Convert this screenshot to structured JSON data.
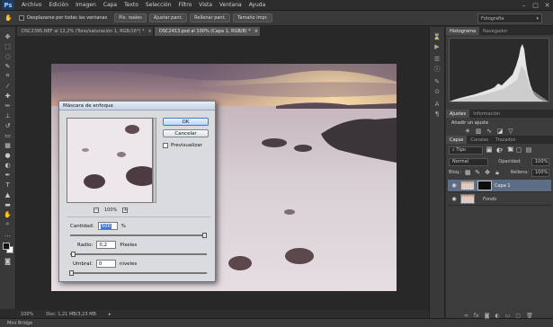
{
  "app": {
    "logo": "Ps"
  },
  "menu": [
    "Archivo",
    "Edición",
    "Imagen",
    "Capa",
    "Texto",
    "Selección",
    "Filtro",
    "Vista",
    "Ventana",
    "Ayuda"
  ],
  "options_bar": {
    "scroll_all_label": "Desplazarse por todas las ventanas",
    "buttons": [
      "Píx. reales",
      "Ajustar pant.",
      "Rellenar pant.",
      "Tamaño impr."
    ],
    "workspace": "Fotografía"
  },
  "doc_tabs": [
    {
      "label": "DSC2395.NEF al 12,2% (Tono/saturación 1, RGB/16*) *",
      "active": false
    },
    {
      "label": "DSC2413.psd al 100% (Capa 1, RGB/8) *",
      "active": true
    }
  ],
  "status": {
    "zoom": "100%",
    "doc": "Doc: 1,21 MB/3,23 MB"
  },
  "bottom_bar": {
    "label": "Mini Bridge"
  },
  "panels": {
    "histogram_tabs": [
      "Histograma",
      "Navegador"
    ],
    "adjust_tabs": [
      "Ajustes",
      "Información"
    ],
    "adjust_title": "Añadir un ajuste",
    "layers_tabs": [
      "Capas",
      "Canales",
      "Trazados"
    ],
    "layers_kind": "Tipo",
    "blend_mode": "Normal",
    "opacity_label": "Opacidad:",
    "opacity_value": "100%",
    "lock_label": "Bloq.:",
    "fill_label": "Relleno:",
    "fill_value": "100%",
    "layers": [
      {
        "name": "Capa 1",
        "selected": true,
        "has_mask": true
      },
      {
        "name": "Fondo",
        "selected": false,
        "has_mask": false
      }
    ]
  },
  "dialog": {
    "title": "Máscara de enfoque",
    "ok": "OK",
    "cancel": "Cancelar",
    "preview_label": "Previsualizar",
    "preview_zoom": "100%",
    "zoom_out": "−",
    "zoom_in": "+",
    "amount_label": "Cantidad:",
    "amount_value": "500",
    "amount_unit": "%",
    "radius_label": "Radio:",
    "radius_value": "0,2",
    "radius_unit": "Píxeles",
    "threshold_label": "Umbral:",
    "threshold_value": "0",
    "threshold_unit": "niveles"
  }
}
